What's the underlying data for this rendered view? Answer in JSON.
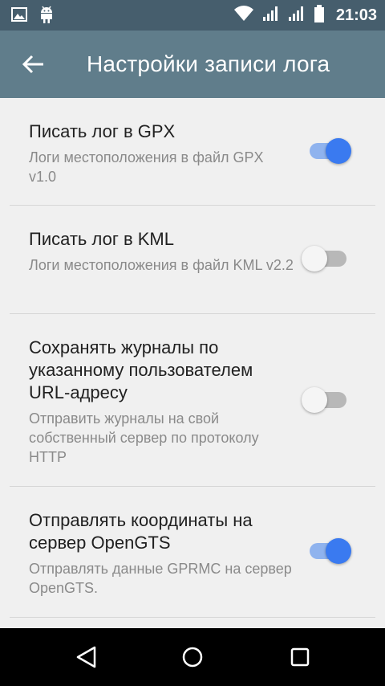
{
  "status_bar": {
    "time": "21:03",
    "icons": [
      "image-icon",
      "android-icon",
      "wifi-icon",
      "signal-icon",
      "signal-icon",
      "battery-icon"
    ]
  },
  "toolbar": {
    "back_icon": "arrow-back-icon",
    "title": "Настройки записи лога"
  },
  "preferences": [
    {
      "title": "Писать лог в GPX",
      "summary": "Логи местоположения в файл GPX v1.0",
      "enabled": true
    },
    {
      "title": "Писать лог в KML",
      "summary": "Логи местоположения в файл KML v2.2",
      "enabled": false
    },
    {
      "title": "Сохранять журналы по указанному пользователем URL-адресу",
      "summary": "Отправить журналы на свой собственный сервер по протоколу HTTP",
      "enabled": false
    },
    {
      "title": "Отправлять координаты на сервер OpenGTS",
      "summary": "Отправлять данные GPRMC на сервер OpenGTS.",
      "enabled": true
    }
  ],
  "colors": {
    "status_bar": "#465e6d",
    "toolbar": "#607d8b",
    "switch_on_thumb": "#3a7af0",
    "switch_on_track": "#8fb3ee",
    "background": "#f0f0f0"
  },
  "nav_bar": {
    "icons": [
      "back-triangle-icon",
      "home-circle-icon",
      "recents-square-icon"
    ]
  }
}
